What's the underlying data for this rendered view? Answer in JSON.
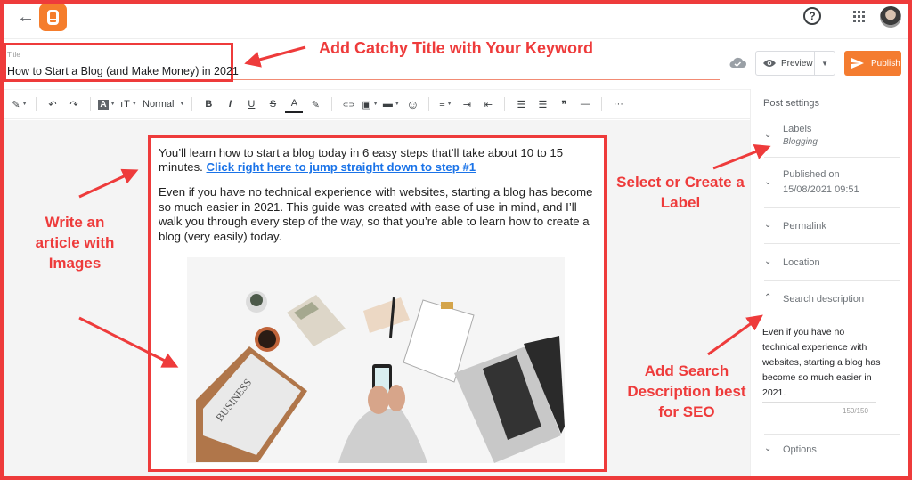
{
  "header": {
    "back_icon": "arrow-left-icon",
    "logo_icon": "blogger-logo-icon",
    "help_glyph": "?",
    "help_icon": "help-circle-icon",
    "apps_icon": "apps-grid-icon",
    "avatar_icon": "user-avatar"
  },
  "post": {
    "title_label": "Title",
    "title_value": "How to Start a Blog (and Make Money) in 2021"
  },
  "actions": {
    "save_status_icon": "cloud-saved-icon",
    "preview_label": "Preview",
    "preview_icon": "eye-icon",
    "preview_dropdown_icon": "caret-down-icon",
    "publish_label": "Publish",
    "publish_icon": "send-icon"
  },
  "toolbar": {
    "items": [
      {
        "name": "compose-mode",
        "glyph": "✎"
      },
      {
        "name": "undo",
        "glyph": "↶"
      },
      {
        "name": "redo",
        "glyph": "↷"
      },
      {
        "name": "font-family",
        "glyph": "A"
      },
      {
        "name": "font-size",
        "glyph": "тT"
      },
      {
        "name": "paragraph-style",
        "label": "Normal"
      },
      {
        "name": "bold",
        "glyph": "B"
      },
      {
        "name": "italic",
        "glyph": "I"
      },
      {
        "name": "underline",
        "glyph": "U"
      },
      {
        "name": "strikethrough",
        "glyph": "S"
      },
      {
        "name": "text-color",
        "glyph": "A"
      },
      {
        "name": "highlight",
        "glyph": "✎"
      },
      {
        "name": "link",
        "glyph": "⊂⊃"
      },
      {
        "name": "insert-image",
        "glyph": "▣"
      },
      {
        "name": "insert-video",
        "glyph": "▬"
      },
      {
        "name": "emoji",
        "glyph": "☺"
      },
      {
        "name": "align",
        "glyph": "≡"
      },
      {
        "name": "indent",
        "glyph": "⇥"
      },
      {
        "name": "outdent",
        "glyph": "⇤"
      },
      {
        "name": "bulleted-list",
        "glyph": "☰"
      },
      {
        "name": "numbered-list",
        "glyph": "☰"
      },
      {
        "name": "quote",
        "glyph": "❞"
      },
      {
        "name": "horizontal-rule",
        "glyph": "—"
      },
      {
        "name": "more",
        "glyph": "···"
      }
    ]
  },
  "body": {
    "para1_text": " You’ll learn how to start a blog today in 6 easy steps that’ll take about 10 to 15 minutes. ",
    "para1_link": "Click right here to jump straight down to step #1",
    "para2_text": "Even if you have no technical experience with websites, starting a blog has become so much easier in 2021. This guide was created with ease of use in mind, and I’ll walk you through every step of the way, so that you’re able to learn how to create a blog (very easily) today.",
    "image_alt": "Desk with newspaper, calculator, coffee, smartphone, clipboard and laptop"
  },
  "sidebar": {
    "title": "Post settings",
    "sections": [
      {
        "label": "Labels",
        "value": "Blogging",
        "expanded": false
      },
      {
        "label": "Published on",
        "value": "15/08/2021 09:51",
        "expanded": false
      },
      {
        "label": "Permalink",
        "expanded": false
      },
      {
        "label": "Location",
        "expanded": false
      },
      {
        "label": "Search description",
        "expanded": true
      },
      {
        "label": "Options",
        "expanded": false
      }
    ],
    "search_description": "Even if you have no technical experience with websites, starting a blog has become so much easier in 2021.",
    "char_count": "150/150"
  },
  "annotations": {
    "title": "Add Catchy Title with Your Keyword",
    "write": "Write an article with Images",
    "label": "Select or Create a Label",
    "seo": "Add Search Description best for SEO",
    "color": "#ee3b3b"
  }
}
